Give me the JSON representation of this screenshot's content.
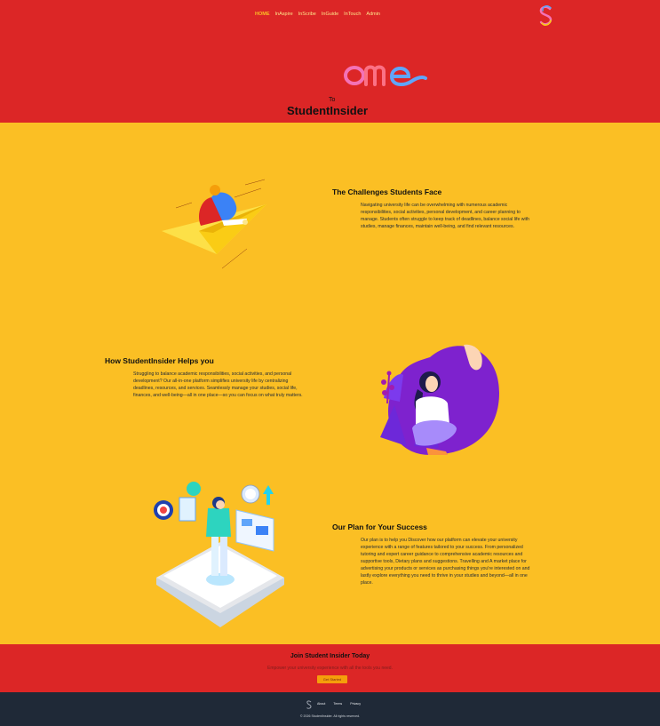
{
  "nav": {
    "items": [
      "HOME",
      "InAspire",
      "InScribe",
      "InGuide",
      "InTouch",
      "Admin"
    ]
  },
  "hero": {
    "ome": "ome",
    "to": "To",
    "brand": "StudentInsider"
  },
  "sections": [
    {
      "title": "The Challenges Students Face",
      "body": "Navigating university life can be overwhelming with numerous academic responsibilities, social activities, personal development, and career planning to manage. Students often struggle to keep track of deadlines, balance social life with studies, manage finances, maintain well-being, and find relevant resources."
    },
    {
      "title": "How StudentInsider Helps you",
      "body": "Struggling to balance academic responsibilities, social activities, and personal development? Our all-in-one platform simplifies university life by centralizing deadlines, resources, and services. Seamlessly manage your studies, social life, finances, and well-being—all in one place—so you can focus on what truly matters."
    },
    {
      "title": "Our Plan for Your Success",
      "body": "Our plan is to help you Discover how our platform can elevate your university experience with a range of features tailored to your success. From personalized tutoring and expert career guidance to comprehensive academic resources and supportive tools, Dietary plans and suggestions. Travelling and A market place for advertising your products or services as purchasing things you're interested on and lastly explore everything you need to thrive in your studies and beyond—all in one place."
    }
  ],
  "cta": {
    "title": "Join Student Insider Today",
    "subtitle": "Empower your university experience with all the tools you need.",
    "button": "Get Started"
  },
  "footer": {
    "links": [
      "About",
      "Terms",
      "Privacy"
    ],
    "copyright": "© 2026 StudentInsider. All rights reserved."
  },
  "colors": {
    "hero_bg": "#dc2626",
    "body_bg": "#fbbf24",
    "footer_bg": "#1f2937"
  }
}
